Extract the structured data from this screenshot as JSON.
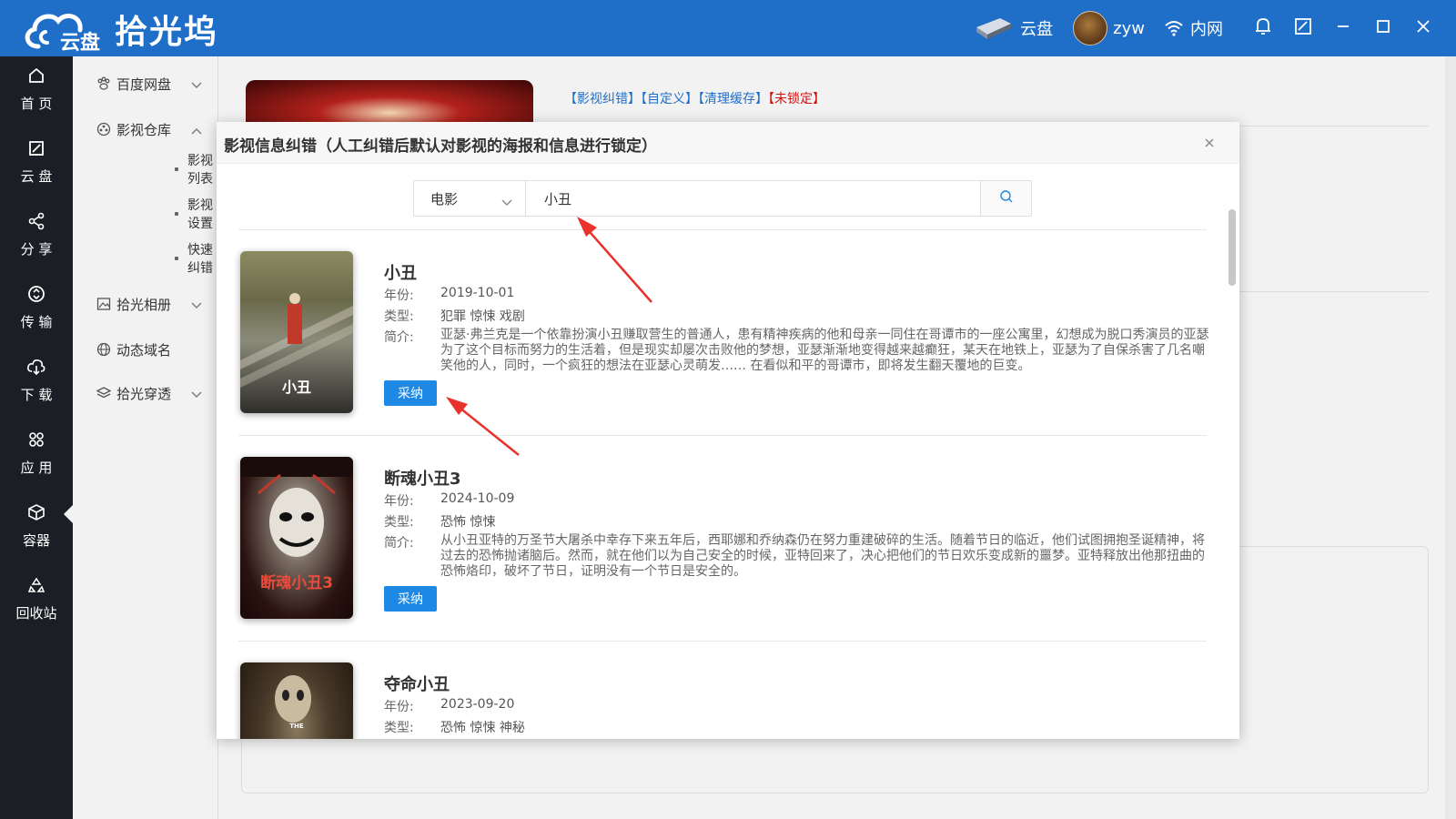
{
  "app": {
    "logo_sub": "云盘",
    "logo_name": "拾光坞",
    "top_right": {
      "disk": "云盘",
      "user": "zyw",
      "network": "内网"
    }
  },
  "leftbar": [
    {
      "label": "首 页",
      "icon": "home-icon"
    },
    {
      "label": "云 盘",
      "icon": "cloud-disk-icon"
    },
    {
      "label": "分 享",
      "icon": "share-icon"
    },
    {
      "label": "传 输",
      "icon": "transfer-icon"
    },
    {
      "label": "下 载",
      "icon": "download-icon"
    },
    {
      "label": "应 用",
      "icon": "apps-icon"
    },
    {
      "label": "容器",
      "icon": "container-icon"
    },
    {
      "label": "回收站",
      "icon": "recycle-icon"
    }
  ],
  "submenu": {
    "baidu": "百度网盘",
    "warehouse": "影视仓库",
    "sub_items": [
      "影视列表",
      "影视设置",
      "快速纠错"
    ],
    "album": "拾光相册",
    "ddns": "动态域名",
    "tunnel": "拾光穿透"
  },
  "background": {
    "links": [
      "【影视纠错】",
      "【自定义】",
      "【清理缓存】"
    ],
    "lock_link": "【未锁定】"
  },
  "modal": {
    "title": "影视信息纠错（人工纠错后默认对影视的海报和信息进行锁定）",
    "search": {
      "type": "电影",
      "query": "小丑"
    },
    "labels": {
      "year": "年份:",
      "genre": "类型:",
      "intro": "简介:",
      "adopt": "采纳"
    },
    "movies": [
      {
        "title": "小丑",
        "year": "2019-10-01",
        "genre": "犯罪 惊悚 戏剧",
        "intro": "亚瑟·弗兰克是一个依靠扮演小丑赚取营生的普通人，患有精神疾病的他和母亲一同住在哥谭市的一座公寓里，幻想成为脱口秀演员的亚瑟为了这个目标而努力的生活着，但是现实却屡次击败他的梦想，亚瑟渐渐地变得越来越癫狂，某天在地铁上，亚瑟为了自保杀害了几名嘲笑他的人，同时，一个疯狂的想法在亚瑟心灵萌发…… 在看似和平的哥谭市，即将发生翻天覆地的巨变。",
        "poster_text": "小丑"
      },
      {
        "title": "断魂小丑3",
        "year": "2024-10-09",
        "genre": "恐怖 惊悚",
        "intro": "从小丑亚特的万圣节大屠杀中幸存下来五年后，西耶娜和乔纳森仍在努力重建破碎的生活。随着节日的临近，他们试图拥抱圣诞精神，将过去的恐怖抛诸脑后。然而，就在他们以为自己安全的时候，亚特回来了，决心把他们的节日欢乐变成新的噩梦。亚特释放出他那扭曲的恐怖烙印，破坏了节日，证明没有一个节日是安全的。",
        "poster_text": "断魂小丑3"
      },
      {
        "title": "夺命小丑",
        "year": "2023-09-20",
        "genre": "恐怖 惊悚 神秘",
        "intro": "",
        "poster_text": "THE"
      }
    ]
  }
}
